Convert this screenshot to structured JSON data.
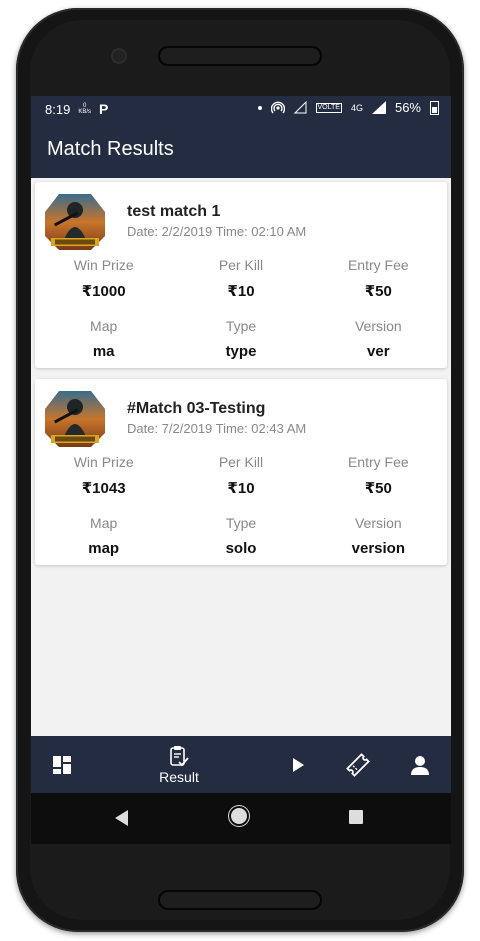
{
  "status_bar": {
    "time": "8:19",
    "data_rate_value": "0",
    "data_rate_unit": "KB/s",
    "network_type": "4G",
    "volte_label": "VOLTE",
    "battery_percent": "56%"
  },
  "app_bar": {
    "title": "Match Results"
  },
  "card_labels": {
    "win_prize": "Win Prize",
    "per_kill": "Per Kill",
    "entry_fee": "Entry Fee",
    "map": "Map",
    "type": "Type",
    "version": "Version"
  },
  "matches": [
    {
      "name": "test match 1",
      "date_time": "Date: 2/2/2019  Time: 02:10 AM",
      "win_prize": "₹1000",
      "per_kill": "₹10",
      "entry_fee": "₹50",
      "map": "ma",
      "type": "type",
      "version": "ver"
    },
    {
      "name": "#Match 03-Testing",
      "date_time": "Date: 7/2/2019  Time: 02:43 AM",
      "win_prize": "₹1043",
      "per_kill": "₹10",
      "entry_fee": "₹50",
      "map": "map",
      "type": "solo",
      "version": "version"
    }
  ],
  "bottom_nav": {
    "items": [
      {
        "icon": "dashboard-icon",
        "label": ""
      },
      {
        "icon": "clipboard-check-icon",
        "label": "Result"
      },
      {
        "icon": "play-icon",
        "label": ""
      },
      {
        "icon": "ticket-icon",
        "label": ""
      },
      {
        "icon": "person-icon",
        "label": ""
      }
    ]
  },
  "colors": {
    "primary": "#232c40",
    "background": "#f2f2f2",
    "card": "#ffffff",
    "muted_text": "#888888"
  }
}
